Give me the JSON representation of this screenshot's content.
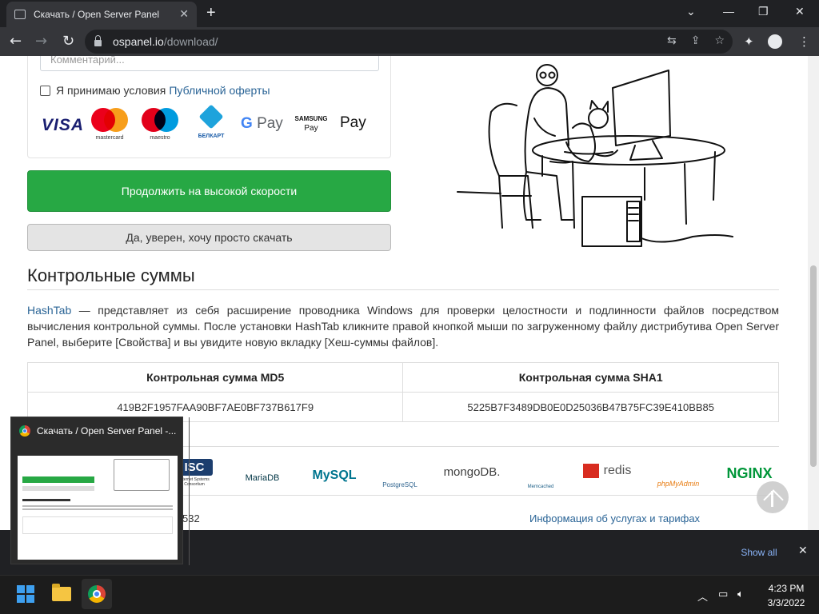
{
  "browser": {
    "tab_title": "Скачать / Open Server Panel",
    "url_host": "ospanel.io",
    "url_path": "/download/"
  },
  "form": {
    "comment_placeholder": "Комментарий...",
    "agree_text": "Я принимаю условия",
    "agree_link": "Публичной оферты",
    "payment_logos": [
      {
        "name": "VISA"
      },
      {
        "name": "mastercard"
      },
      {
        "name": "maestro"
      },
      {
        "name": "БЕЛКАРТ"
      },
      {
        "name": "G Pay"
      },
      {
        "name": "SAMSUNG Pay"
      },
      {
        "name": "Pay"
      }
    ],
    "samsung_top": "SAMSUNG",
    "samsung_bottom": "Pay",
    "gpay_g": "G",
    "gpay_pay": "Pay",
    "apple_pay": "Pay"
  },
  "buttons": {
    "fast": "Продолжить на высокой скорости",
    "slow": "Да, уверен, хочу просто скачать"
  },
  "checksums": {
    "heading": "Контрольные суммы",
    "hashtab_link": "HashTab",
    "paragraph": " — представляет из себя расширение проводника Windows для проверки целостности и подлинности файлов посредством вычисления контрольной суммы. После установки HashTab кликните правой кнопкой мыши по загруженному файлу дистрибутива Open Server Panel, выберите [Свойства] и вы увидите новую вкладку [Хеш-суммы файлов].",
    "md5_header": "Контрольная сумма MD5",
    "sha1_header": "Контрольная сумма SHA1",
    "md5_value": "419B2F1957FAA90BF7AE0BF737B617F9",
    "sha1_value": "5225B7F3489DB0E0D25036B47B75FC39E410BB85"
  },
  "tech_logos": {
    "isc": "ISC",
    "isc_caption": "Internet Systems Consortium",
    "mariadb": "MariaDB",
    "mysql": "MySQL",
    "postgres": "PostgreSQL",
    "mongodb": "mongoDB.",
    "memcached": "Memcached",
    "redis": "redis",
    "phpmyadmin": "phpMyAdmin",
    "nginx": "NGINX"
  },
  "footer": {
    "left_fragment": "532",
    "link": "Информация об услугах и тарифах"
  },
  "download_bar": {
    "show_all": "Show all"
  },
  "taskbar_preview": {
    "title": "Скачать / Open Server Panel -..."
  },
  "clock": {
    "time": "4:23 PM",
    "date": "3/3/2022"
  },
  "colors": {
    "accent_green": "#27a844",
    "link_blue": "#2a6496",
    "chrome_dark": "#202124"
  }
}
